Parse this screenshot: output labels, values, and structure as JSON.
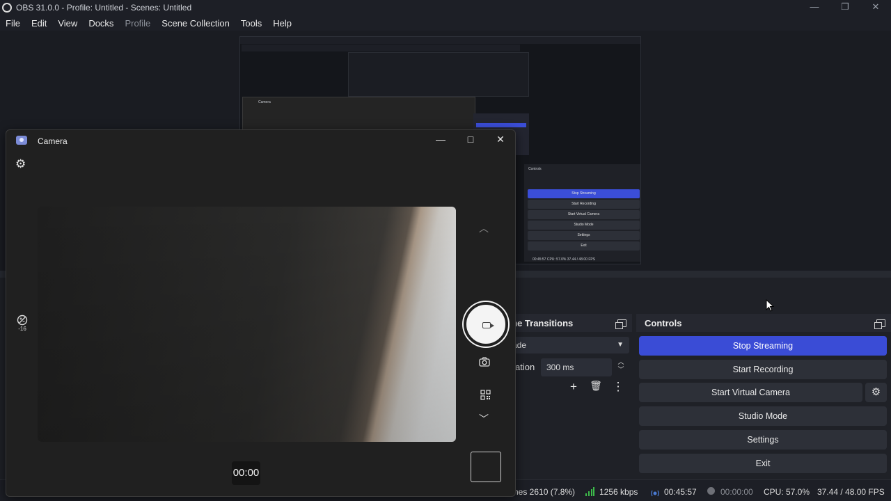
{
  "obs": {
    "title": "OBS 31.0.0 - Profile: Untitled - Scenes: Untitled",
    "window_buttons": [
      "—",
      "❐",
      "✕"
    ],
    "menu": [
      "File",
      "Edit",
      "View",
      "Docks",
      "Profile",
      "Scene Collection",
      "Tools",
      "Help"
    ],
    "nested_preview": {
      "camera_title": "Camera",
      "controls_title": "Controls",
      "buttons": [
        "Stop Streaming",
        "Start Recording",
        "Start Virtual Camera",
        "Studio Mode",
        "Settings",
        "Exit"
      ],
      "status": "00:45:57   CPU: 57.0%   37.44 / 48.00 FPS"
    },
    "transitions": {
      "title": "Scene Transitions",
      "selected": "ade",
      "duration_label": "ation",
      "duration_value": "300 ms",
      "add_icon": "+",
      "delete_icon": "🗑",
      "more_icon": "⋮"
    },
    "controls": {
      "title": "Controls",
      "stop_streaming": "Stop Streaming",
      "start_recording": "Start Recording",
      "start_virtual_camera": "Start Virtual Camera",
      "studio_mode": "Studio Mode",
      "settings": "Settings",
      "exit": "Exit",
      "settings_icon": "⚙"
    },
    "status": {
      "frames": "nes 2610 (7.8%)",
      "bitrate": "1256 kbps",
      "stream_time": "00:45:57",
      "rec_time": "00:00:00",
      "cpu": "CPU: 57.0%",
      "fps": "37.44 / 48.00 FPS"
    },
    "colors": {
      "accent": "#3a4cd6",
      "bitrate_ok": "#3dbb4a",
      "stream_icon": "#4a7bd4"
    }
  },
  "camera": {
    "title": "Camera",
    "minimize": "—",
    "maximize": "□",
    "close": "✕",
    "settings_icon": "⚙",
    "brightness_value": "-16",
    "chevron_up": "︿",
    "chevron_down": "﹀",
    "photo_icon": "📷",
    "timer": "00:00"
  }
}
